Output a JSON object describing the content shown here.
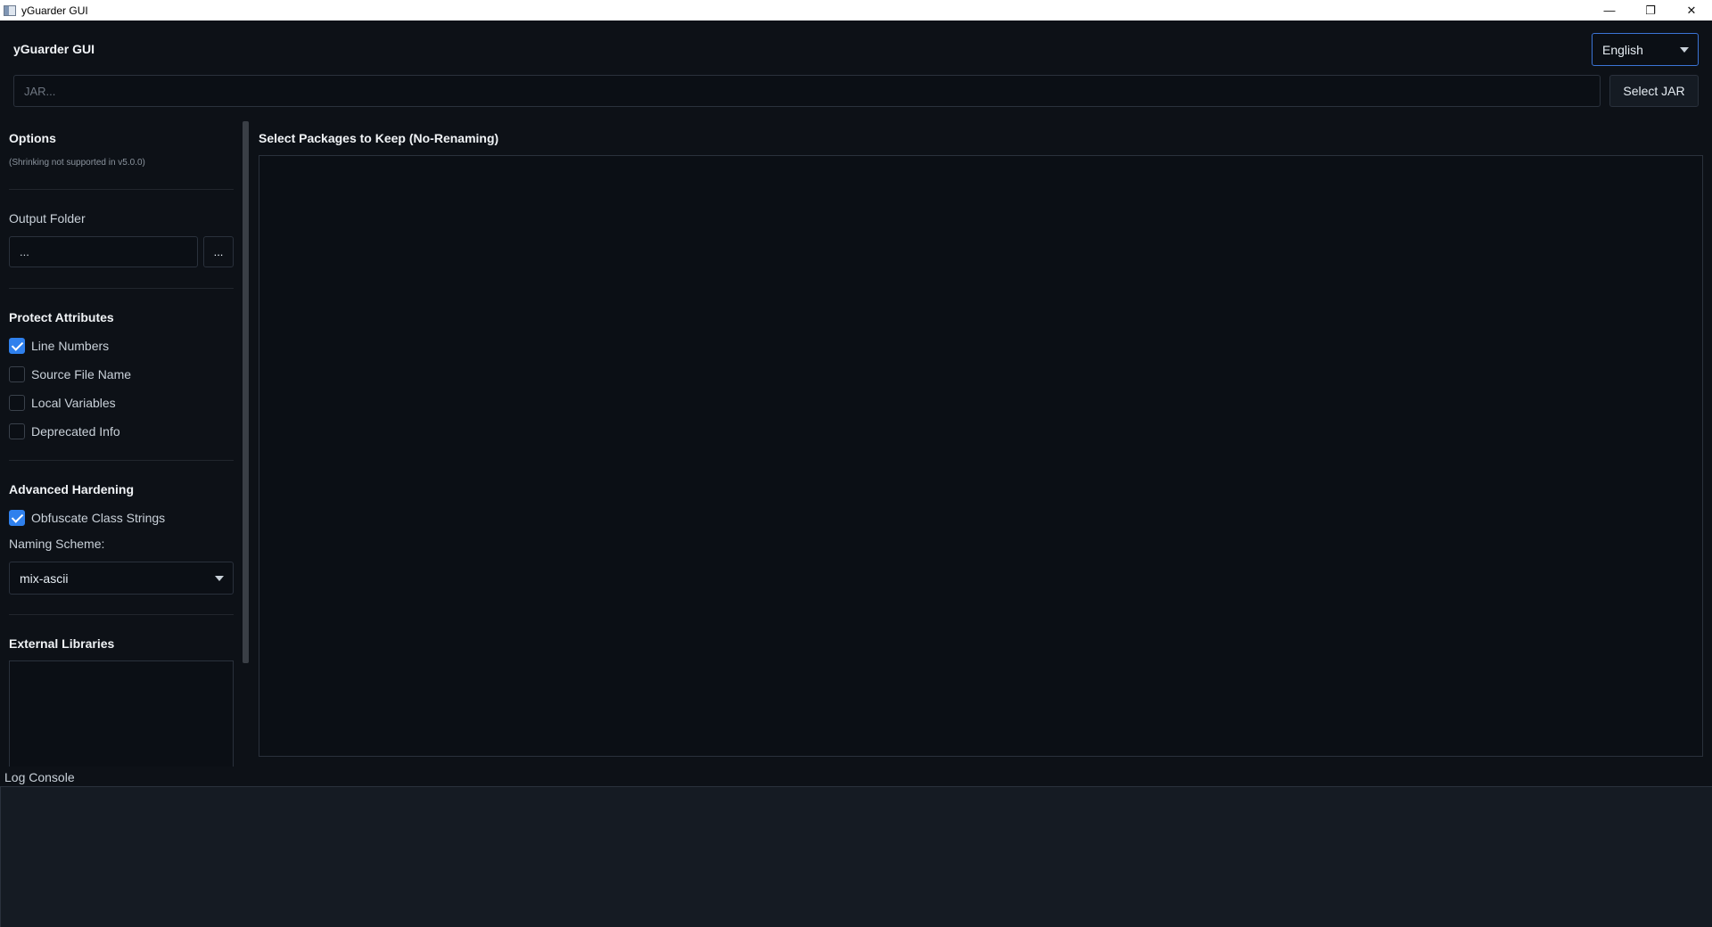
{
  "window": {
    "title": "yGuarder GUI",
    "minimize": "—",
    "restore": "❐",
    "close": "✕"
  },
  "header": {
    "app_title": "yGuarder GUI",
    "language": "English",
    "jar_placeholder": "JAR...",
    "select_jar_label": "Select JAR"
  },
  "options": {
    "title": "Options",
    "note": "(Shrinking not supported in v5.0.0)",
    "output_folder_label": "Output Folder",
    "output_folder_value": "...",
    "browse_label": "..."
  },
  "protect": {
    "title": "Protect Attributes",
    "items": [
      {
        "label": "Line Numbers",
        "checked": true
      },
      {
        "label": "Source File Name",
        "checked": false
      },
      {
        "label": "Local Variables",
        "checked": false
      },
      {
        "label": "Deprecated Info",
        "checked": false
      }
    ]
  },
  "advanced": {
    "title": "Advanced Hardening",
    "obfuscate_label": "Obfuscate Class Strings",
    "obfuscate_checked": true,
    "naming_label": "Naming Scheme:",
    "naming_value": "mix-ascii"
  },
  "external": {
    "title": "External Libraries"
  },
  "packages": {
    "title": "Select Packages to Keep (No-Renaming)"
  },
  "log": {
    "title": "Log Console"
  },
  "colors": {
    "background": "#0d1117",
    "accent": "#2f80ed",
    "border": "#2a313c"
  }
}
